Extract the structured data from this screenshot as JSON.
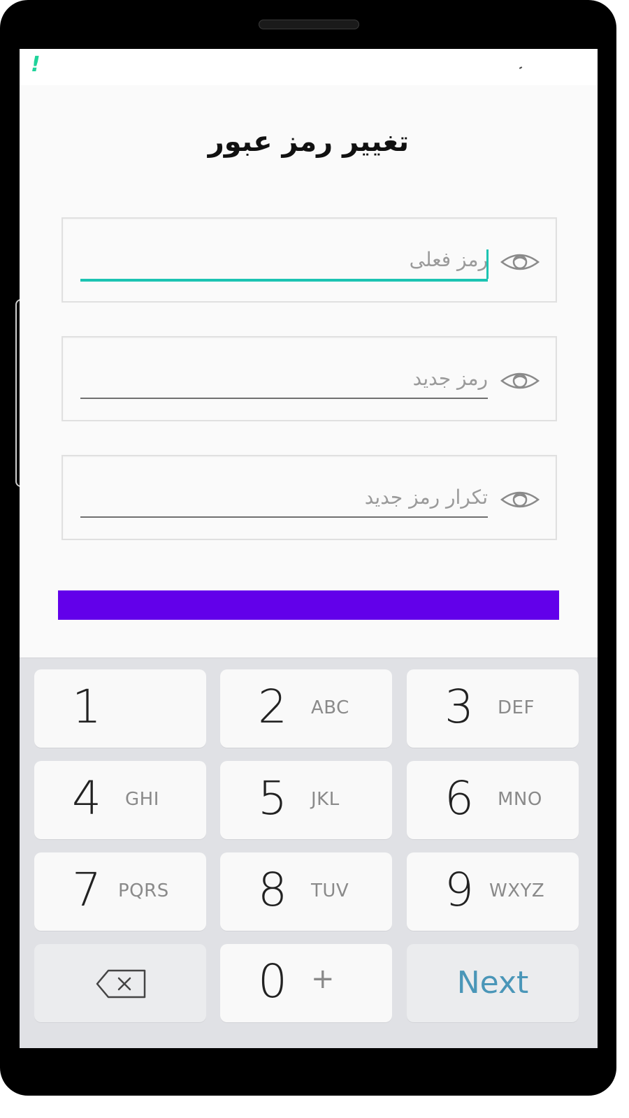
{
  "status_bar": {
    "alert_glyph": "!"
  },
  "page": {
    "title": "تغییر رمز عبور"
  },
  "fields": [
    {
      "placeholder": "رمز فعلی",
      "icon": "eye-icon",
      "focused": true
    },
    {
      "placeholder": "رمز جدید",
      "icon": "eye-icon",
      "focused": false
    },
    {
      "placeholder": "تکرار رمز جدید",
      "icon": "eye-icon",
      "focused": false
    }
  ],
  "submit_button": {
    "label": "",
    "color": "#6200ea"
  },
  "colors": {
    "accent": "#1cc4b2",
    "primary": "#6200ea",
    "next_key": "#4a96b8",
    "status_alert": "#1fd39a"
  },
  "keyboard": {
    "keys": [
      {
        "digit": "1",
        "letters": ""
      },
      {
        "digit": "2",
        "letters": "ABC"
      },
      {
        "digit": "3",
        "letters": "DEF"
      },
      {
        "digit": "4",
        "letters": "GHI"
      },
      {
        "digit": "5",
        "letters": "JKL"
      },
      {
        "digit": "6",
        "letters": "MNO"
      },
      {
        "digit": "7",
        "letters": "PQRS"
      },
      {
        "digit": "8",
        "letters": "TUV"
      },
      {
        "digit": "9",
        "letters": "WXYZ"
      },
      {
        "digit": "0",
        "letters": "+"
      }
    ],
    "backspace_icon": "backspace-icon",
    "next_label": "Next"
  }
}
